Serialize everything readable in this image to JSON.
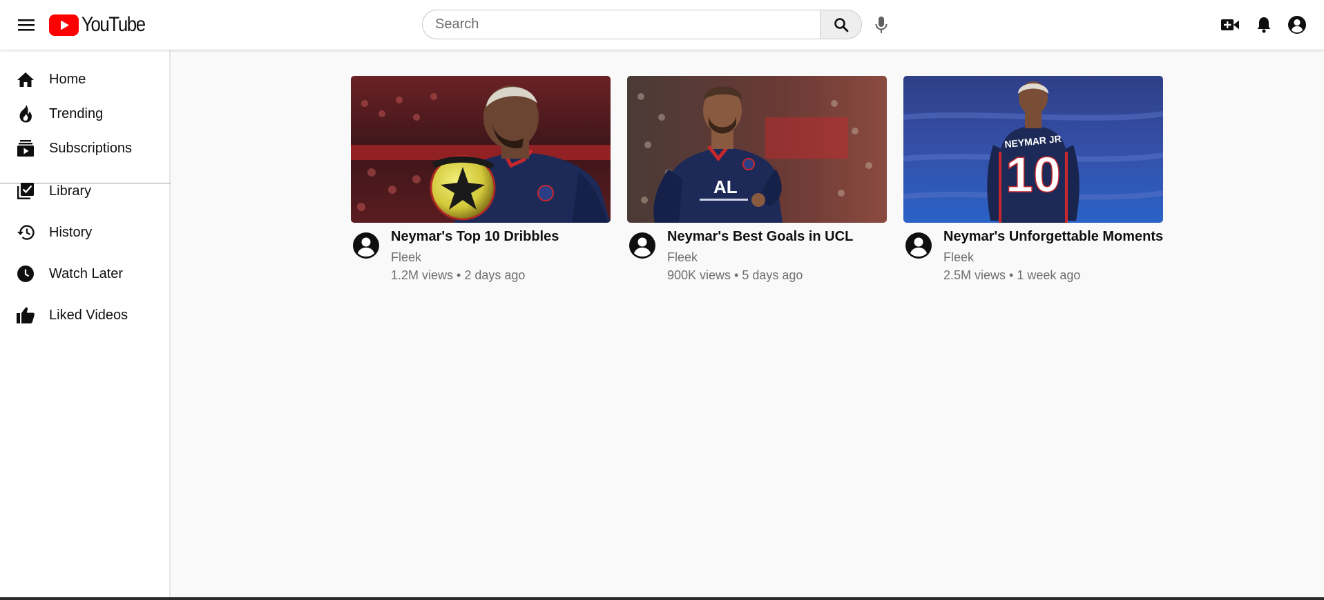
{
  "header": {
    "logo_text": "YouTube",
    "search_placeholder": "Search",
    "search_value": ""
  },
  "sidebar": {
    "items": [
      {
        "label": "Home",
        "icon": "home-icon"
      },
      {
        "label": "Trending",
        "icon": "flame-icon"
      },
      {
        "label": "Subscriptions",
        "icon": "subscriptions-icon"
      },
      {
        "label": "Library",
        "icon": "library-icon"
      },
      {
        "label": "History",
        "icon": "history-icon"
      },
      {
        "label": "Watch Later",
        "icon": "clock-icon"
      },
      {
        "label": "Liked Videos",
        "icon": "thumbs-up-icon"
      }
    ]
  },
  "videos": [
    {
      "title": "Neymar's Top 10 Dribbles",
      "channel": "Fleek",
      "meta": "1.2M views • 2 days ago"
    },
    {
      "title": "Neymar's Best Goals in UCL",
      "channel": "Fleek",
      "meta": "900K views • 5 days ago"
    },
    {
      "title": "Neymar's Unforgettable Moments",
      "channel": "Fleek",
      "meta": "2.5M views • 1 week ago"
    }
  ],
  "thumbnail_jersey_text": {
    "name": "NEYMAR JR",
    "number": "10"
  },
  "colors": {
    "brand_red": "#ff0000",
    "jersey_navy": "#1d2a57",
    "background": "#f9f9f9"
  }
}
